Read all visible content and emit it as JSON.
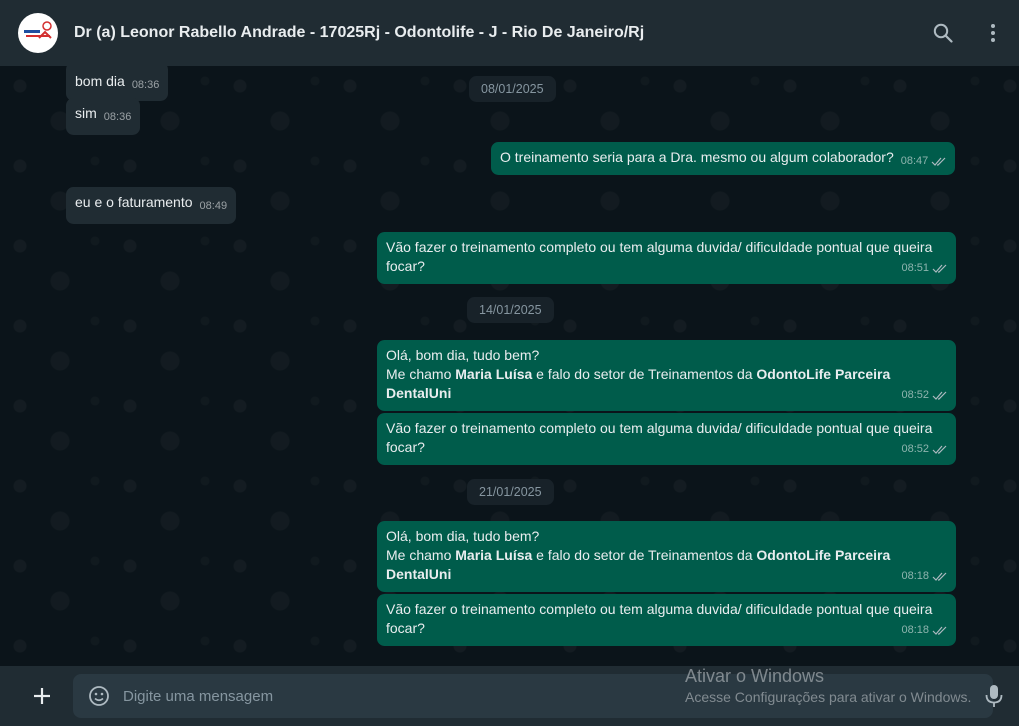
{
  "header": {
    "contact_name": "Dr (a) Leonor Rabello Andrade - 17025Rj - Odontolife - J - Rio De Janeiro/Rj",
    "icons": [
      "search-icon",
      "menu-dots-icon"
    ]
  },
  "messages": [
    {
      "dir": "in",
      "text": "bom dia",
      "time": "08:36"
    },
    {
      "dir": "in",
      "text": "sim",
      "time": "08:36"
    },
    {
      "date": "08/01/2025"
    },
    {
      "dir": "out",
      "text": "O treinamento seria para a Dra. mesmo ou algum colaborador?",
      "time": "08:47",
      "status": "read"
    },
    {
      "dir": "in",
      "text": "eu e o faturamento",
      "time": "08:49"
    },
    {
      "dir": "out",
      "text": "Vão fazer o treinamento completo ou tem alguma duvida/ dificuldade pontual que queira focar?",
      "time": "08:51",
      "status": "read"
    },
    {
      "date": "14/01/2025"
    },
    {
      "dir": "out",
      "line1": "Olá, bom dia, tudo bem?",
      "line2_a": "Me chamo ",
      "line2_bold1": "Maria Luísa",
      "line2_b": " e falo do setor de Treinamentos da ",
      "line2_bold2": "OdontoLife Parceira DentalUni",
      "time": "08:52",
      "status": "read"
    },
    {
      "dir": "out",
      "text": "Vão fazer o treinamento completo ou tem alguma duvida/ dificuldade pontual que queira focar?",
      "time": "08:52",
      "status": "read"
    },
    {
      "date": "21/01/2025"
    },
    {
      "dir": "out",
      "line1": "Olá, bom dia, tudo bem?",
      "line2_a": "Me chamo ",
      "line2_bold1": "Maria Luísa",
      "line2_b": " e falo do setor de Treinamentos da ",
      "line2_bold2": "OdontoLife Parceira DentalUni",
      "time": "08:18",
      "status": "read"
    },
    {
      "dir": "out",
      "text": "Vão fazer o treinamento completo ou tem alguma duvida/ dificuldade pontual que queira focar?",
      "time": "08:18",
      "status": "read"
    }
  ],
  "footer": {
    "placeholder": "Digite uma mensagem",
    "icons": [
      "plus-icon",
      "emoji-icon",
      "microphone-icon"
    ]
  },
  "watermark": {
    "title": "Ativar o Windows",
    "subtitle": "Acesse Configurações para ativar o Windows."
  },
  "colors": {
    "header_bg": "#202c33",
    "chat_bg": "#0b141a",
    "incoming_bubble": "#202c33",
    "outgoing_bubble": "#005c4b",
    "input_bg": "#2a3942"
  }
}
